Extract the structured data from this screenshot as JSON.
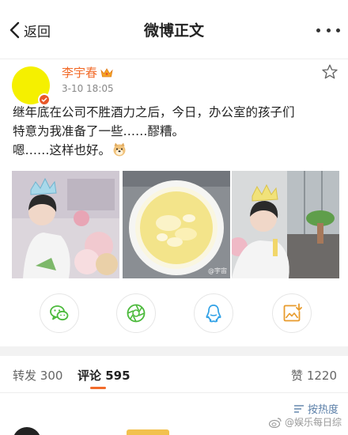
{
  "nav": {
    "back_label": "返回",
    "title": "微博正文"
  },
  "post": {
    "author": "李宇春",
    "time": "3-10 18:05",
    "text_line_1": "继年底在公司不胜酒力之后，今日，办公室的孩子们",
    "text_line_2": "特意为我准备了一些……醪糟。",
    "text_line_3": "嗯……这样也好。",
    "images": [
      {
        "icon": "photo-person-with-crown-flowers"
      },
      {
        "icon": "photo-bowl-of-jiuniang"
      },
      {
        "icon": "photo-person-with-crown-plant"
      }
    ],
    "image_watermark": "@宇宙"
  },
  "share": [
    {
      "icon": "wechat-icon"
    },
    {
      "icon": "moments-icon"
    },
    {
      "icon": "qq-icon"
    },
    {
      "icon": "save-image-icon"
    }
  ],
  "tabs": {
    "repost_label": "转发",
    "repost_count": "300",
    "comment_label": "评论",
    "comment_count": "595",
    "like_label": "赞",
    "like_count": "1220"
  },
  "sort_label": "按热度",
  "page_watermark": "@娱乐每日综",
  "colors": {
    "accent": "#f26c2b",
    "avatar": "#f5f000",
    "link": "#5b7fa8"
  }
}
